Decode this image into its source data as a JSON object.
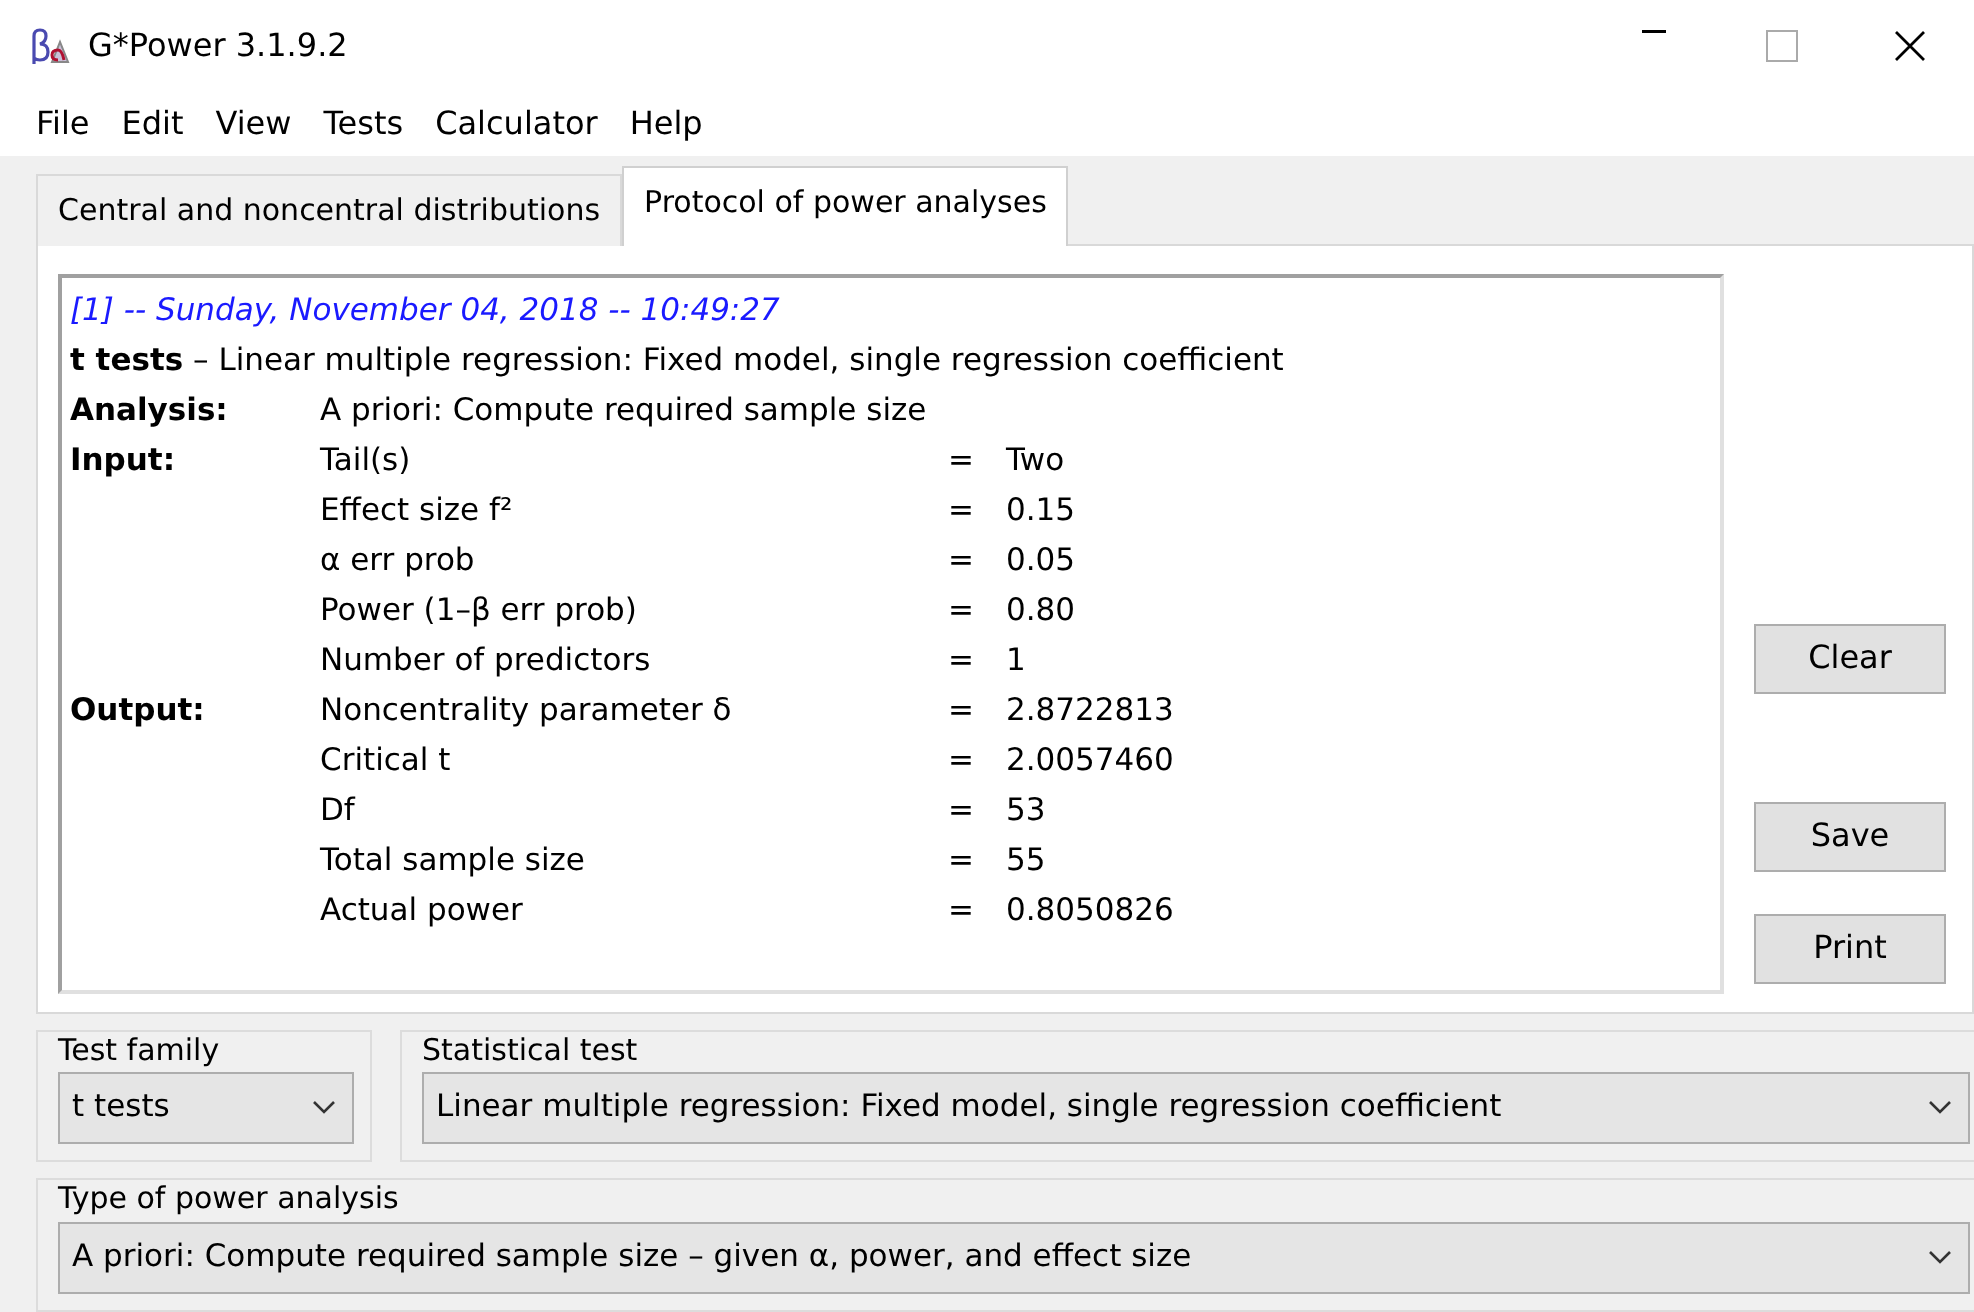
{
  "window": {
    "title": "G*Power 3.1.9.2"
  },
  "menu": [
    "File",
    "Edit",
    "View",
    "Tests",
    "Calculator",
    "Help"
  ],
  "tabs": [
    {
      "label": "Central and noncentral distributions",
      "selected": false
    },
    {
      "label": "Protocol of power analyses",
      "selected": true
    }
  ],
  "protocol": {
    "header": "[1] -- Sunday, November 04, 2018 -- 10:49:27",
    "title": "**t tests** – Linear multiple regression: Fixed model, single regression coefficient",
    "sections": [
      {
        "label": "Analysis:",
        "text": "A priori: Compute required sample size"
      },
      {
        "label": "Input:",
        "rows": [
          {
            "name": "Tail(s)",
            "sep": "=",
            "value": "Two"
          },
          {
            "name": "Effect size f²",
            "sep": "=",
            "value": "0.15"
          },
          {
            "name": "α err prob",
            "sep": "=",
            "value": "0.05"
          },
          {
            "name": "Power (1–β err prob)",
            "sep": "=",
            "value": "0.80"
          },
          {
            "name": "Number of predictors",
            "sep": "=",
            "value": "1"
          }
        ]
      },
      {
        "label": "Output:",
        "rows": [
          {
            "name": "Noncentrality parameter δ",
            "sep": "=",
            "value": "2.8722813"
          },
          {
            "name": "Critical t",
            "sep": "=",
            "value": "2.0057460"
          },
          {
            "name": "Df",
            "sep": "=",
            "value": "53"
          },
          {
            "name": "Total sample size",
            "sep": "=",
            "value": "55"
          },
          {
            "name": "Actual power",
            "sep": "=",
            "value": "0.8050826"
          }
        ]
      }
    ]
  },
  "buttons": [
    "Clear",
    "Save",
    "Print"
  ],
  "test_family": {
    "legend": "Test family",
    "value": "t tests"
  },
  "statistical_test": {
    "legend": "Statistical test",
    "value": "Linear multiple regression: Fixed model, single regression coefficient"
  },
  "power_analysis_type": {
    "legend": "Type of power analysis",
    "value": "A priori: Compute required sample size – given α, power, and effect size"
  }
}
